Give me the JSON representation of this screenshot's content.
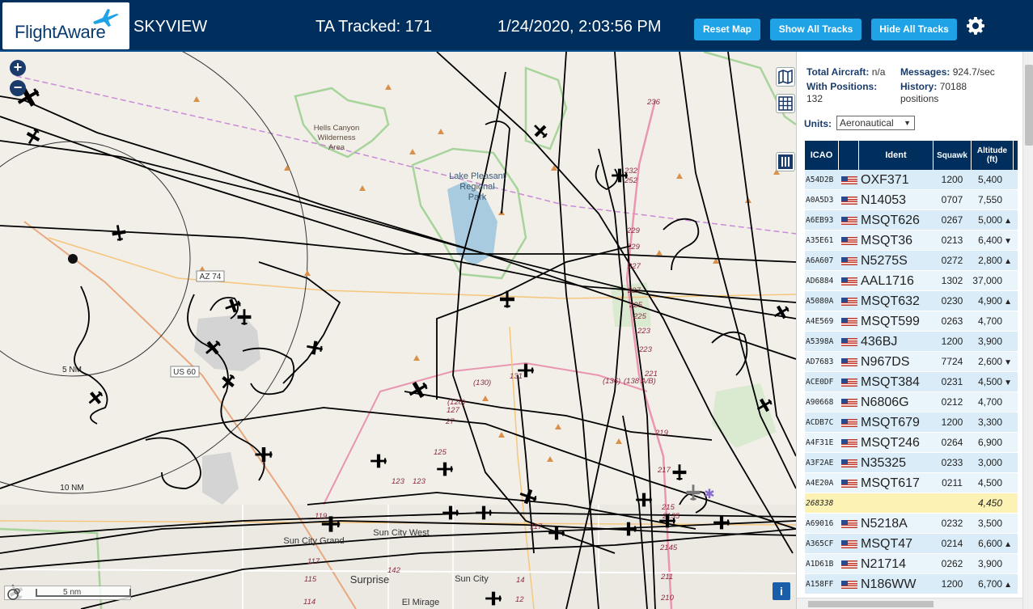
{
  "header": {
    "logo_text": "FlightAware",
    "app_name": "SKYVIEW",
    "tracked": "TA Tracked: 171",
    "datetime": "1/24/2020, 2:03:56 PM",
    "buttons": {
      "reset": "Reset Map",
      "show_all": "Show All Tracks",
      "hide_all": "Hide All Tracks"
    },
    "settings_icon": "gear-icon",
    "colors": {
      "bar": "#002f5d",
      "button": "#1fa3e6"
    }
  },
  "map": {
    "zoom_in": "+",
    "zoom_out": "−",
    "scale_label": "5 nm",
    "info": "i",
    "labels": {
      "hells_canyon": [
        "Hells Canyon",
        "Wilderness",
        "Area"
      ],
      "lake_pleasant": [
        "Lake Pleasant",
        "Regional",
        "Park"
      ],
      "az74": "AZ 74",
      "us60": "US 60",
      "ring5": "5 NM",
      "ring10": "10 NM",
      "sun_city_grand": "Sun City Grand",
      "sun_city_west": "Sun City West",
      "sun_city": "Sun City",
      "surprise": "Surprise",
      "el_mirage": "El Mirage"
    },
    "road_numbers": [
      "236",
      "232",
      "252",
      "229",
      "229",
      "227",
      "227",
      "225",
      "225",
      "223",
      "223",
      "221",
      "219",
      "217",
      "215",
      "2135",
      "2145",
      "211",
      "210",
      "(130)",
      "131",
      "(128)",
      "127",
      "27",
      "(136)",
      "(138 A/B)",
      "125",
      "123",
      "123",
      "119",
      "117",
      "115",
      "114",
      "142",
      "14",
      "12",
      "117",
      "(128 A/B)"
    ]
  },
  "panel": {
    "total_aircraft_label": "Total Aircraft:",
    "total_aircraft_value": "n/a",
    "with_positions_label": "With Positions:",
    "with_positions_value": "132",
    "messages_label": "Messages:",
    "messages_value": "924.7/sec",
    "history_label": "History:",
    "history_value": "70188",
    "history_unit": "positions",
    "units_label": "Units:",
    "units_value": "Aeronautical",
    "columns": [
      "ICAO",
      "Ident",
      "Squawk",
      "Altitude (ft)"
    ],
    "rows": [
      {
        "icao": "A54D2B",
        "ident": "OXF371",
        "squawk": "1200",
        "alt": "5,400",
        "trend": ""
      },
      {
        "icao": "A0A5D3",
        "ident": "N14053",
        "squawk": "0707",
        "alt": "7,550",
        "trend": ""
      },
      {
        "icao": "A6EB93",
        "ident": "MSQT626",
        "squawk": "0267",
        "alt": "5,000",
        "trend": "▲"
      },
      {
        "icao": "A35E61",
        "ident": "MSQT36",
        "squawk": "0213",
        "alt": "6,400",
        "trend": "▼"
      },
      {
        "icao": "A6A607",
        "ident": "N5275S",
        "squawk": "0272",
        "alt": "2,800",
        "trend": "▲"
      },
      {
        "icao": "AD6884",
        "ident": "AAL1716",
        "squawk": "1302",
        "alt": "37,000",
        "trend": ""
      },
      {
        "icao": "A5080A",
        "ident": "MSQT632",
        "squawk": "0230",
        "alt": "4,900",
        "trend": "▲"
      },
      {
        "icao": "A4E569",
        "ident": "MSQT599",
        "squawk": "0263",
        "alt": "4,700",
        "trend": ""
      },
      {
        "icao": "A5398A",
        "ident": "436BJ",
        "squawk": "1200",
        "alt": "3,900",
        "trend": ""
      },
      {
        "icao": "AD7683",
        "ident": "N967DS",
        "squawk": "7724",
        "alt": "2,600",
        "trend": "▼"
      },
      {
        "icao": "ACE0DF",
        "ident": "MSQT384",
        "squawk": "0231",
        "alt": "4,500",
        "trend": "▼"
      },
      {
        "icao": "A90668",
        "ident": "N6806G",
        "squawk": "0212",
        "alt": "4,700",
        "trend": ""
      },
      {
        "icao": "ACDB7C",
        "ident": "MSQT679",
        "squawk": "1200",
        "alt": "3,300",
        "trend": ""
      },
      {
        "icao": "A4F31E",
        "ident": "MSQT246",
        "squawk": "0264",
        "alt": "6,900",
        "trend": ""
      },
      {
        "icao": "A3F2AE",
        "ident": "N35325",
        "squawk": "0233",
        "alt": "3,000",
        "trend": ""
      },
      {
        "icao": "A4E20A",
        "ident": "MSQT617",
        "squawk": "0211",
        "alt": "4,500",
        "trend": ""
      },
      {
        "icao": "268338",
        "ident": "",
        "squawk": "",
        "alt": "4,450",
        "trend": "",
        "highlight": true
      },
      {
        "icao": "A69016",
        "ident": "N5218A",
        "squawk": "0232",
        "alt": "3,500",
        "trend": ""
      },
      {
        "icao": "A365CF",
        "ident": "MSQT47",
        "squawk": "0214",
        "alt": "6,600",
        "trend": "▲"
      },
      {
        "icao": "A1D61B",
        "ident": "N21714",
        "squawk": "0262",
        "alt": "3,900",
        "trend": ""
      },
      {
        "icao": "A158FF",
        "ident": "N186WW",
        "squawk": "1200",
        "alt": "6,700",
        "trend": "▲"
      }
    ]
  }
}
